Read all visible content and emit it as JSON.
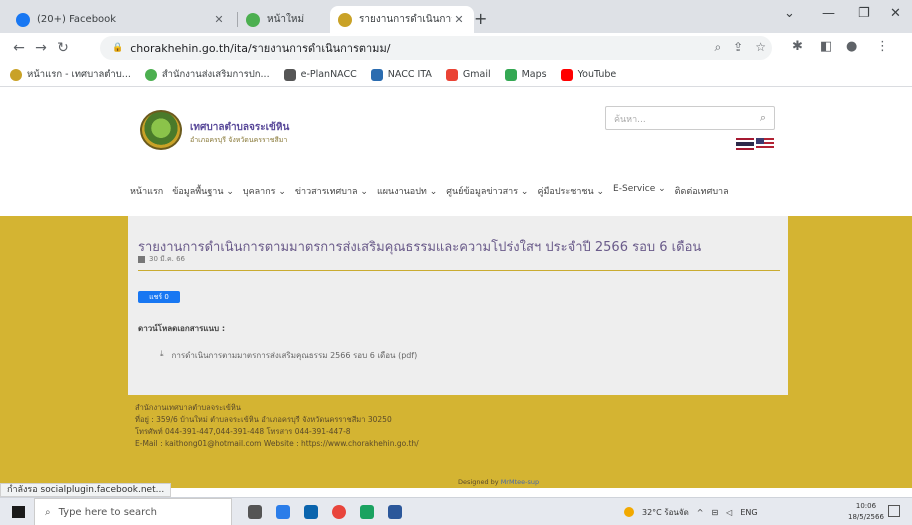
{
  "browser": {
    "tabs": [
      {
        "title": "(20+) Facebook",
        "icon": "facebook-icon",
        "color": "#1877f2"
      },
      {
        "title": "หน้าใหม่",
        "icon": "chrome-icon",
        "color": "#4caf50"
      },
      {
        "title": "รายงานการดำเนินการตามมาตรการส่ง",
        "icon": "site-icon",
        "color": "#c9a227"
      }
    ],
    "url": "chorakhehin.go.th/ita/รายงานการดำเนินการตามม/",
    "bookmarks": [
      {
        "label": "หน้าแรก - เทศบาลตำบ...",
        "icon": "site-icon",
        "color": "#c9a227"
      },
      {
        "label": "สำนักงานส่งเสริมการปก...",
        "icon": "chrome-icon",
        "color": "#4caf50"
      },
      {
        "label": "e-PlanNACC",
        "icon": "home-icon",
        "color": "#555555"
      },
      {
        "label": "NACC ITA",
        "icon": "nacc-icon",
        "color": "#2b6cb0"
      },
      {
        "label": "Gmail",
        "icon": "gmail-icon",
        "color": "#ea4335"
      },
      {
        "label": "Maps",
        "icon": "maps-icon",
        "color": "#34a853"
      },
      {
        "label": "YouTube",
        "icon": "youtube-icon",
        "color": "#ff0000"
      }
    ],
    "status_url": "กำลังรอ socialplugin.facebook.net..."
  },
  "site": {
    "name": "เทศบาลตำบลจระเข้หิน",
    "subname": "อำเภอครบุรี จังหวัดนครราชสีมา",
    "search_placeholder": "ค้นหา...",
    "menu": [
      "หน้าแรก",
      "ข้อมูลพื้นฐาน",
      "บุคลากร",
      "ข่าวสารเทศบาล",
      "แผนงานอปท",
      "ศูนย์ข้อมูลข่าวสาร",
      "คู่มือประชาชน",
      "E-Service",
      "ติดต่อเทศบาล"
    ]
  },
  "article": {
    "title": "รายงานการดำเนินการตามมาตรการส่งเสริมคุณธรรมและความโปร่งใสฯ ประจำปี 2566 รอบ 6 เดือน",
    "date": "30 มี.ค. 66",
    "share_label": "แชร์ 0",
    "attachments_label": "ดาวน์โหลดเอกสารแนบ :",
    "attachment": "การดำเนินการตามมาตรการส่งเสริมคุณธรรม 2566 รอบ 6 เดือน (pdf)"
  },
  "footer": {
    "lines": [
      "สำนักงานเทศบาลตำบลจระเข้หิน",
      "ที่อยู่ : 359/6 บ้านใหม่ ตำบลจระเข้หิน อำเภอครบุรี จังหวัดนครราชสีมา 30250",
      "โทรศัพท์ 044-391-447,044-391-448 โทรสาร 044-391-447-8",
      "E-Mail : kaithong01@hotmail.com   Website : https://www.chorakhehin.go.th/"
    ],
    "designed_by": "Designed by",
    "designer": "MrMtee-sup"
  },
  "taskbar": {
    "search_placeholder": "Type here to search",
    "weather": "32°C ร้อนจัด",
    "lang": "ENG",
    "time": "10:06",
    "date": "18/5/2566"
  }
}
